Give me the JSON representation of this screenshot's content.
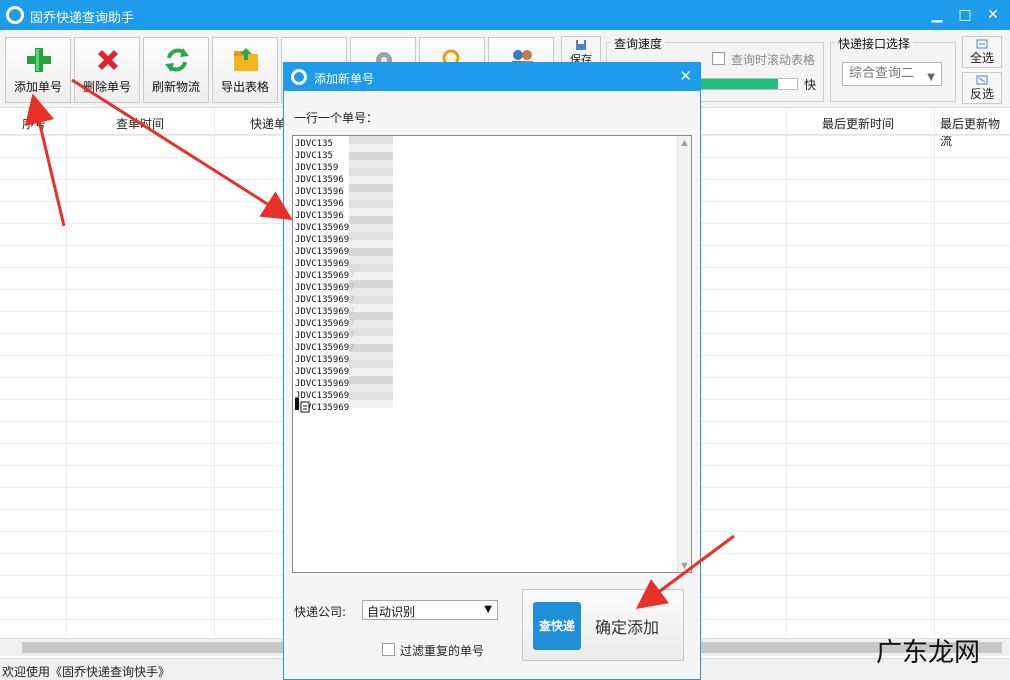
{
  "window": {
    "title": "固乔快递查询助手",
    "minimize": "▁",
    "maximize": "□",
    "close": "✕"
  },
  "toolbar": {
    "buttons": [
      {
        "label": "添加单号",
        "icon": "add-plus-icon"
      },
      {
        "label": "删除单号",
        "icon": "delete-x-icon"
      },
      {
        "label": "刷新物流",
        "icon": "refresh-icon"
      },
      {
        "label": "导出表格",
        "icon": "export-folder-icon"
      }
    ],
    "save_label": "保存",
    "speed_group_title": "查询速度",
    "scroll_table_label": "查询时滚动表格",
    "speed_fast_label": "快",
    "speed_level": 0.8,
    "api_group_title": "快递接口选择",
    "api_selected": "综合查询二",
    "select_all": "全选",
    "invert_select": "反选"
  },
  "table": {
    "columns": [
      "序号",
      "查单时间",
      "快递单",
      "最后更新时间",
      "最后更新物流"
    ]
  },
  "dialog": {
    "title": "添加新单号",
    "prompt": "一行一个单号：",
    "tracking_numbers": [
      "JDVC135",
      "JDVC135",
      "JDVC1359",
      "JDVC13596",
      "JDVC13596",
      "JDVC13596",
      "JDVC13596",
      "JDVC135969",
      "JDVC135969",
      "JDVC135969",
      "JDVC135969",
      "JDVC1359697",
      "JDVC1359697",
      "JDVC1359697",
      "JDVC1359697",
      "JDVC1359697",
      "JDVC1359697",
      "JDVC1359697",
      "JDVC135969",
      "JDVC135969",
      "JDVC135969",
      "JDVC135969",
      "JDVC135969"
    ],
    "company_label": "快递公司:",
    "company_selected": "自动识别",
    "filter_label": "过滤重复的单号",
    "confirm_logo": "查快递",
    "confirm_label": "确定添加",
    "close": "✕"
  },
  "status": {
    "text": "欢迎使用《固乔快递查询快手》"
  },
  "watermark": {
    "text": "广东龙网"
  },
  "colors": {
    "titlebar": "#1e9bea",
    "annotation_arrow": "#e8302a",
    "progress": "#1fbf7a"
  }
}
